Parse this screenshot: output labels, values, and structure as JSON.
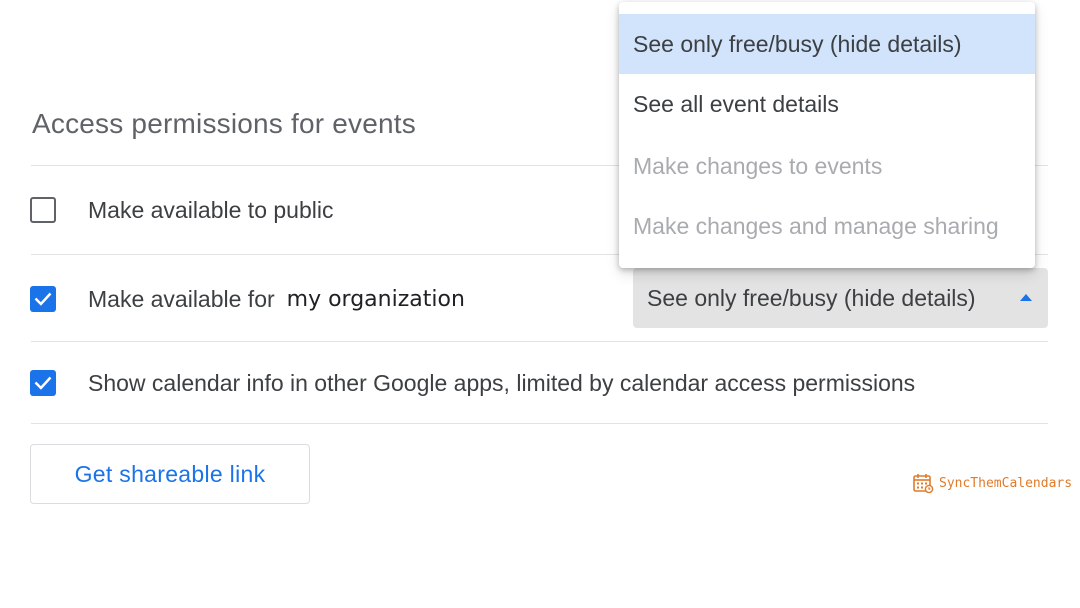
{
  "section": {
    "title": "Access permissions for events"
  },
  "permissions": {
    "public": {
      "label": "Make available to public",
      "checked": false
    },
    "organization": {
      "label": "Make available for",
      "org_name": "my organization",
      "checked": true,
      "selected_value": "See only free/busy (hide details)"
    },
    "google_apps": {
      "label": "Show calendar info in other Google apps, limited by calendar access permissions",
      "checked": true
    }
  },
  "dropdown": {
    "options": [
      {
        "label": "See only free/busy (hide details)",
        "state": "selected"
      },
      {
        "label": "See all event details",
        "state": "enabled"
      },
      {
        "label": "Make changes to events",
        "state": "disabled"
      },
      {
        "label": "Make changes and manage sharing",
        "state": "disabled"
      }
    ]
  },
  "share": {
    "button_label": "Get shareable link"
  },
  "watermark": {
    "text": "SyncThemCalendars",
    "icon": "calendar-icon"
  },
  "colors": {
    "accent": "#1a73e8",
    "selected_option_bg": "#d2e3fc",
    "select_bg": "#e3e3e3",
    "disabled_text": "#a8abaf",
    "watermark": "#e07b2a"
  }
}
